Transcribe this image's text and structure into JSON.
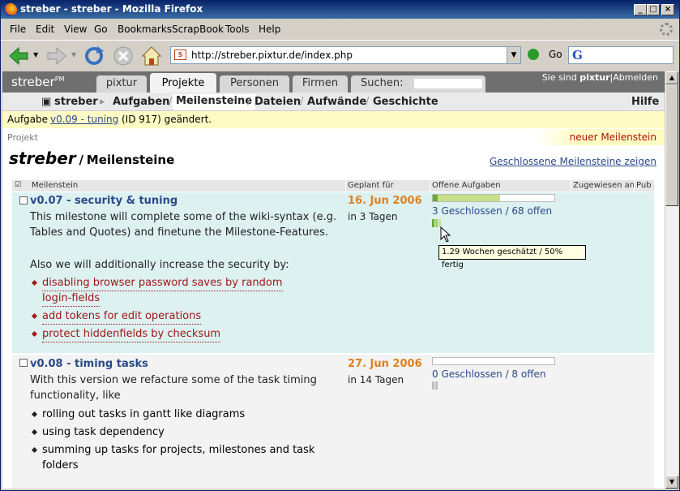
{
  "window": {
    "title": "streber - streber - Mozilla Firefox"
  },
  "menu": [
    "File",
    "Edit",
    "View",
    "Go",
    "Bookmarks",
    "ScrapBook",
    "Tools",
    "Help"
  ],
  "toolbar": {
    "url": "http://streber.pixtur.de/index.php",
    "go_label": "Go"
  },
  "app": {
    "logo": "streber",
    "logo_sup": "PM",
    "tabs": [
      "pixtur",
      "Projekte",
      "Personen",
      "Firmen",
      "Suchen:"
    ],
    "user_prefix": "Sie sind",
    "user_name": "pixtur",
    "logout": "Abmelden"
  },
  "subnav": {
    "project": "streber",
    "items": [
      "Aufgaben",
      "Meilensteine",
      "Dateien",
      "Aufwände",
      "Geschichte"
    ],
    "help": "Hilfe"
  },
  "notice": {
    "prefix": "Aufgabe",
    "link": "v0.09 - tuning",
    "suffix": "(ID 917) geändert."
  },
  "crumb": "Projekt",
  "new_milestone": "neuer Meilenstein",
  "title": {
    "project": "streber",
    "sep": "/",
    "page": "Meilensteine"
  },
  "closed_link": "Geschlossene Meilensteine zeigen",
  "table": {
    "headers": [
      "Meilenstein",
      "Geplant für",
      "Offene Aufgaben",
      "Zugewiesen an",
      "Pub"
    ],
    "rows": [
      {
        "title": "v0.07 - security & tuning",
        "desc1": "This milestone will complete some of the wiki-syntax (e.g.",
        "desc2": "Tables and Quotes) and finetune the Milestone-Features.",
        "desc3": "Also we will additionally increase the security by:",
        "items": [
          "disabling browser password saves by random",
          "login-fields",
          "add tokens for edit operations",
          "protect hiddenfields by checksum"
        ],
        "date": "16. Jun 2006",
        "days": "in 3 Tagen",
        "tasks": "3 Geschlossen  /  68 offen",
        "progress": 0.55,
        "closed_fraction": 0.04
      },
      {
        "title": "v0.08 - timing tasks",
        "desc1": "With this version we refacture some of the task timing",
        "desc2": "functionality, like",
        "items": [
          "rolling out tasks in gantt like diagrams",
          "using task dependency",
          "summing up tasks for projects, milestones and task",
          "folders"
        ],
        "date": "27. Jun 2006",
        "days": "in 14 Tagen",
        "tasks": "0 Geschlossen  /  8 offen",
        "progress": 0.0,
        "closed_fraction": 0.0
      }
    ]
  },
  "tooltip": "1.29 Wochen geschätzt / 50% fertig"
}
